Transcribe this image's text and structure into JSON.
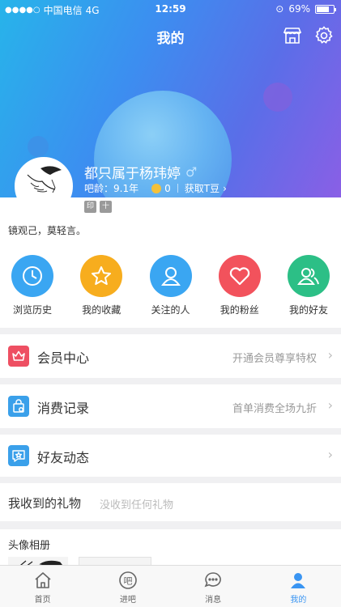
{
  "status_bar": {
    "carrier": "中国电信",
    "network": "4G",
    "time": "12:59",
    "battery": "69%"
  },
  "nav": {
    "title": "我的",
    "shop_icon": "store-icon",
    "settings_icon": "gear-icon"
  },
  "profile": {
    "username": "都只属于杨玮婷",
    "gender_symbol": "♂",
    "age_label": "吧龄：9.1年",
    "tdou_count": "0",
    "get_tdou": "获取T豆",
    "badges": [
      "印",
      "十"
    ],
    "motto": "镜观己，莫轻言。"
  },
  "quick_actions": [
    {
      "label": "浏览历史",
      "icon": "clock-icon",
      "color": "#3aa6f2"
    },
    {
      "label": "我的收藏",
      "icon": "star-icon",
      "color": "#f7ad1e"
    },
    {
      "label": "关注的人",
      "icon": "person-icon",
      "color": "#3aa6f2"
    },
    {
      "label": "我的粉丝",
      "icon": "heart-icon",
      "color": "#f2525c"
    },
    {
      "label": "我的好友",
      "icon": "friends-icon",
      "color": "#2cbf86"
    }
  ],
  "rows": {
    "vip": {
      "label": "会员中心",
      "hint": "开通会员尊享特权",
      "icon": "crown-icon",
      "color": "#ee4f62"
    },
    "spend": {
      "label": "消费记录",
      "hint": "首单消费全场九折",
      "icon": "bag-icon",
      "color": "#3aa0ea"
    },
    "friends_feed": {
      "label": "好友动态",
      "hint": "",
      "icon": "chat-star-icon",
      "color": "#3aa0ea"
    }
  },
  "gifts": {
    "title": "我收到的礼物",
    "empty": "没收到任何礼物"
  },
  "album": {
    "title": "头像相册"
  },
  "tabs": [
    {
      "label": "首页",
      "icon": "home-icon",
      "active": false
    },
    {
      "label": "进吧",
      "icon": "ba-icon",
      "active": false
    },
    {
      "label": "消息",
      "icon": "message-icon",
      "active": false
    },
    {
      "label": "我的",
      "icon": "user-icon",
      "active": true
    }
  ]
}
